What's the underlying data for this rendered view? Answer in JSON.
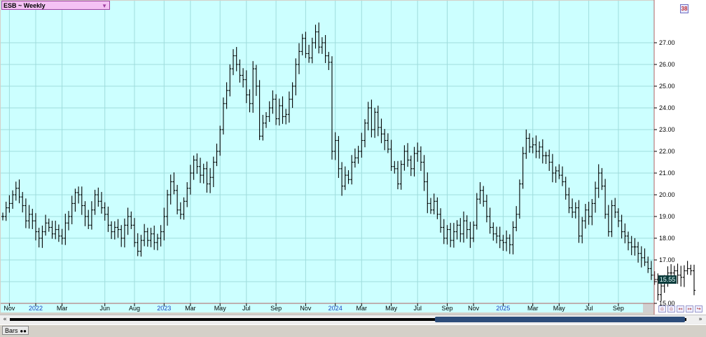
{
  "header": {
    "symbol_label": "ESB ~ Weekly"
  },
  "corner_badge": "38",
  "last_price_label": "15.55",
  "bottom": {
    "tab_label": "Bars"
  },
  "colors": {
    "plot_bg": "#ccffff",
    "grid": "#9fdcdc",
    "bars": "#000000",
    "frame": "#b06060"
  },
  "chart_data": {
    "type": "ohlc-bar",
    "title": "ESB ~ Weekly",
    "y_ticks": [
      "15.00",
      "16.00",
      "17.00",
      "18.00",
      "19.00",
      "20.00",
      "21.00",
      "22.00",
      "23.00",
      "24.00",
      "25.00",
      "26.00",
      "27.00"
    ],
    "ylim": [
      14.45,
      28.6
    ],
    "x_ticks": [
      {
        "label": "Nov",
        "week": 2,
        "year": false
      },
      {
        "label": "2022",
        "week": 10,
        "year": true
      },
      {
        "label": "Mar",
        "week": 18,
        "year": false
      },
      {
        "label": "Jun",
        "week": 31,
        "year": false
      },
      {
        "label": "Aug",
        "week": 40,
        "year": false
      },
      {
        "label": "2023",
        "week": 49,
        "year": true
      },
      {
        "label": "Mar",
        "week": 57,
        "year": false
      },
      {
        "label": "May",
        "week": 66,
        "year": false
      },
      {
        "label": "Jul",
        "week": 74,
        "year": false
      },
      {
        "label": "Sep",
        "week": 83,
        "year": false
      },
      {
        "label": "Nov",
        "week": 92,
        "year": false
      },
      {
        "label": "2024",
        "week": 101,
        "year": true
      },
      {
        "label": "Mar",
        "week": 109,
        "year": false
      },
      {
        "label": "May",
        "week": 118,
        "year": false
      },
      {
        "label": "Jul",
        "week": 126,
        "year": false
      },
      {
        "label": "Sep",
        "week": 135,
        "year": false
      },
      {
        "label": "Nov",
        "week": 143,
        "year": false
      },
      {
        "label": "2025",
        "week": 152,
        "year": true
      },
      {
        "label": "Mar",
        "week": 161,
        "year": false
      },
      {
        "label": "May",
        "week": 169,
        "year": false
      },
      {
        "label": "Jul",
        "week": 178,
        "year": false
      },
      {
        "label": "Sep",
        "week": 187,
        "year": false
      }
    ],
    "grid": true,
    "closes": [
      19.0,
      19.4,
      19.6,
      20.0,
      20.3,
      19.9,
      19.5,
      18.8,
      19.1,
      18.8,
      18.3,
      18.0,
      18.3,
      18.7,
      18.5,
      18.2,
      18.4,
      18.1,
      18.0,
      18.7,
      19.0,
      19.6,
      20.1,
      20.0,
      19.5,
      19.0,
      18.6,
      19.3,
      20.0,
      19.7,
      19.4,
      19.1,
      18.6,
      18.3,
      18.5,
      18.4,
      18.0,
      18.6,
      19.0,
      18.6,
      17.8,
      17.4,
      17.9,
      18.3,
      17.9,
      18.2,
      17.8,
      18.0,
      18.3,
      19.0,
      20.0,
      20.6,
      20.2,
      19.3,
      19.1,
      19.7,
      20.3,
      21.0,
      21.6,
      21.3,
      20.9,
      21.2,
      20.5,
      20.8,
      21.5,
      22.0,
      23.0,
      24.2,
      24.8,
      25.8,
      26.4,
      26.0,
      25.5,
      25.3,
      24.6,
      24.2,
      25.8,
      25.0,
      22.7,
      23.3,
      23.6,
      24.0,
      24.4,
      23.5,
      24.1,
      23.6,
      23.7,
      24.4,
      25.0,
      26.0,
      26.6,
      27.2,
      26.5,
      26.3,
      27.0,
      27.5,
      26.8,
      27.0,
      26.4,
      26.1,
      22.0,
      22.5,
      21.2,
      20.4,
      20.9,
      20.7,
      21.5,
      21.7,
      22.0,
      22.5,
      23.3,
      24.0,
      23.0,
      23.8,
      23.1,
      22.8,
      22.5,
      22.1,
      21.3,
      21.2,
      20.5,
      21.4,
      22.0,
      21.6,
      21.2,
      21.9,
      22.0,
      21.5,
      20.6,
      19.6,
      19.3,
      19.7,
      19.1,
      18.5,
      18.0,
      18.4,
      17.9,
      18.3,
      18.6,
      18.2,
      18.8,
      18.4,
      18.0,
      18.6,
      19.8,
      20.2,
      19.7,
      19.0,
      18.5,
      18.2,
      18.1,
      17.9,
      17.8,
      18.0,
      17.7,
      18.5,
      19.1,
      20.5,
      21.9,
      22.6,
      22.2,
      22.3,
      22.0,
      22.2,
      21.8,
      21.8,
      21.5,
      21.0,
      21.1,
      20.9,
      20.6,
      20.0,
      19.4,
      19.2,
      19.4,
      18.1,
      18.8,
      19.3,
      19.0,
      19.6,
      20.3,
      21.0,
      20.4,
      19.1,
      18.3,
      19.5,
      19.2,
      18.8,
      18.3,
      18.1,
      17.8,
      17.6,
      17.6,
      17.3,
      17.1,
      16.9,
      16.6,
      16.3,
      16.1,
      15.4,
      15.8,
      16.1,
      16.4,
      16.4,
      16.5,
      16.3,
      16.2,
      16.5,
      16.6,
      16.5,
      15.6
    ]
  }
}
